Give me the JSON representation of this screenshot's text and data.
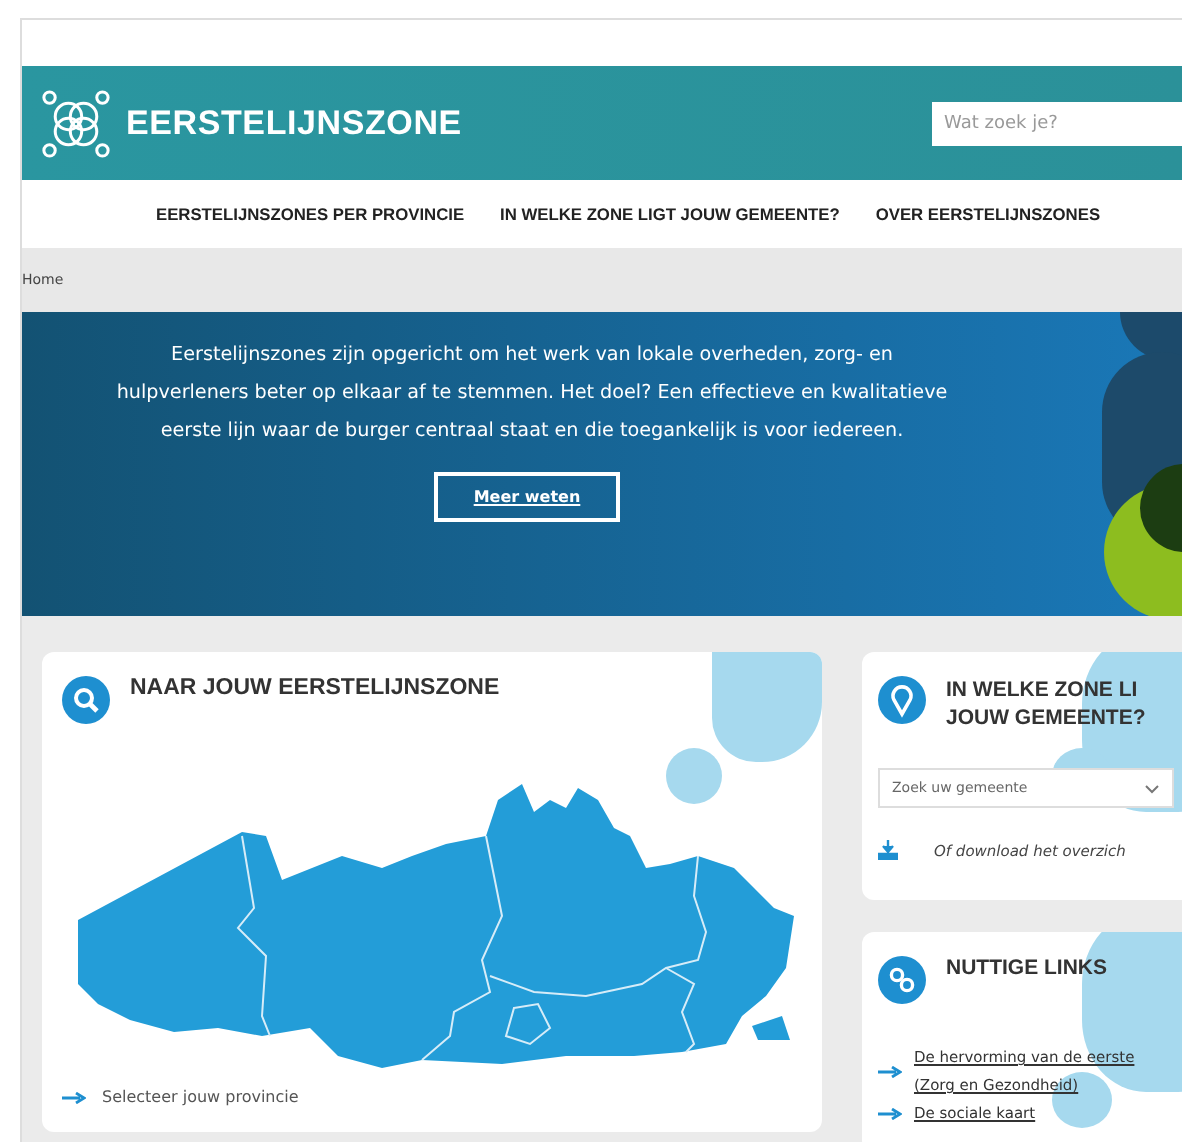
{
  "header": {
    "logo_text": "EERSTELIJNSZONE",
    "search": {
      "placeholder": "Wat zoek je?"
    }
  },
  "nav": {
    "items": [
      {
        "label": "EERSTELIJNSZONES PER PROVINCIE"
      },
      {
        "label": "IN WELKE ZONE LIGT JOUW GEMEENTE?"
      },
      {
        "label": "OVER EERSTELIJNSZONES"
      }
    ]
  },
  "breadcrumb": [
    "Home"
  ],
  "hero": {
    "text": "Eerstelijnszones zijn opgericht om het werk van lokale overheden, zorg- en hulpverleners beter op elkaar af te stemmen. Het doel? Een effectieve en kwalitatieve eerste lijn waar de burger centraal staat en die toegankelijk is voor iedereen.",
    "button": "Meer weten"
  },
  "map_card": {
    "title": "NAAR JOUW EERSTELIJNSZONE",
    "link": "Selecteer jouw provincie"
  },
  "zone_card": {
    "title_lines": [
      "IN WELKE ZONE LI",
      "JOUW GEMEENTE?"
    ],
    "select": {
      "placeholder": "Zoek uw gemeente"
    },
    "download": "Of download het overzich"
  },
  "links_card": {
    "title": "NUTTIGE LINKS",
    "links": [
      {
        "lines": [
          "De hervorming van de eerste",
          "(Zorg en Gezondheid)"
        ]
      },
      {
        "lines": [
          "De sociale kaart"
        ]
      }
    ]
  }
}
